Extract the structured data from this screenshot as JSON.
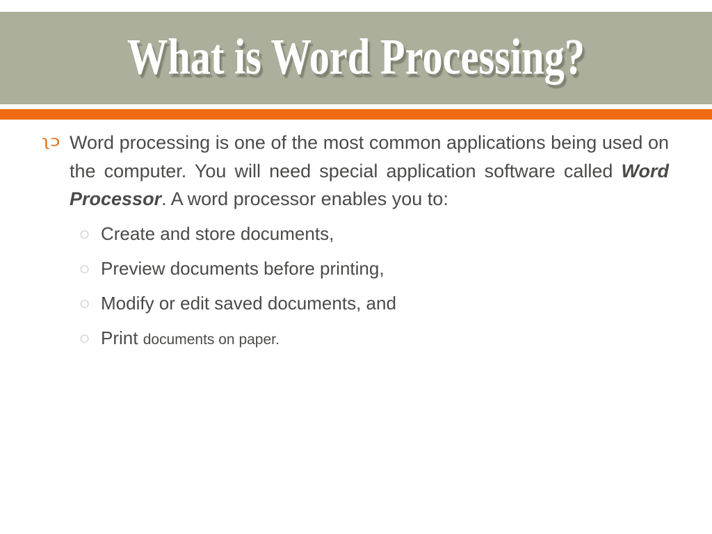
{
  "slide": {
    "title": "What is Word Processing?",
    "colors": {
      "title_band": "#abaf9b",
      "accent_rule": "#ef6c13",
      "body_text": "#4a4a48",
      "level1_bullet": "#e0701b",
      "level2_bullet": "#b9b9b4",
      "background": "#ffffff",
      "title_text": "#ffffff"
    },
    "body": {
      "level1": [
        {
          "bullet_glyph": "ʅɔ",
          "bullet_name": "curly-es-bullet",
          "text_before_emphasis": "Word processing is one of the most common applications being used on the computer. You will need special application software called ",
          "emphasis": "Word Processor",
          "text_after_emphasis": ". A word processor enables you to:"
        }
      ],
      "level2": [
        {
          "bullet_glyph": "○",
          "bullet_name": "hollow-circle-bullet",
          "text": "Create and store documents,",
          "small_tail": ""
        },
        {
          "bullet_glyph": "○",
          "bullet_name": "hollow-circle-bullet",
          "text": "Preview documents before printing,",
          "small_tail": ""
        },
        {
          "bullet_glyph": "○",
          "bullet_name": "hollow-circle-bullet",
          "text": "Modify or edit saved documents, and",
          "small_tail": ""
        },
        {
          "bullet_glyph": "○",
          "bullet_name": "hollow-circle-bullet",
          "text": "Print ",
          "small_tail": "documents on paper."
        }
      ]
    }
  }
}
